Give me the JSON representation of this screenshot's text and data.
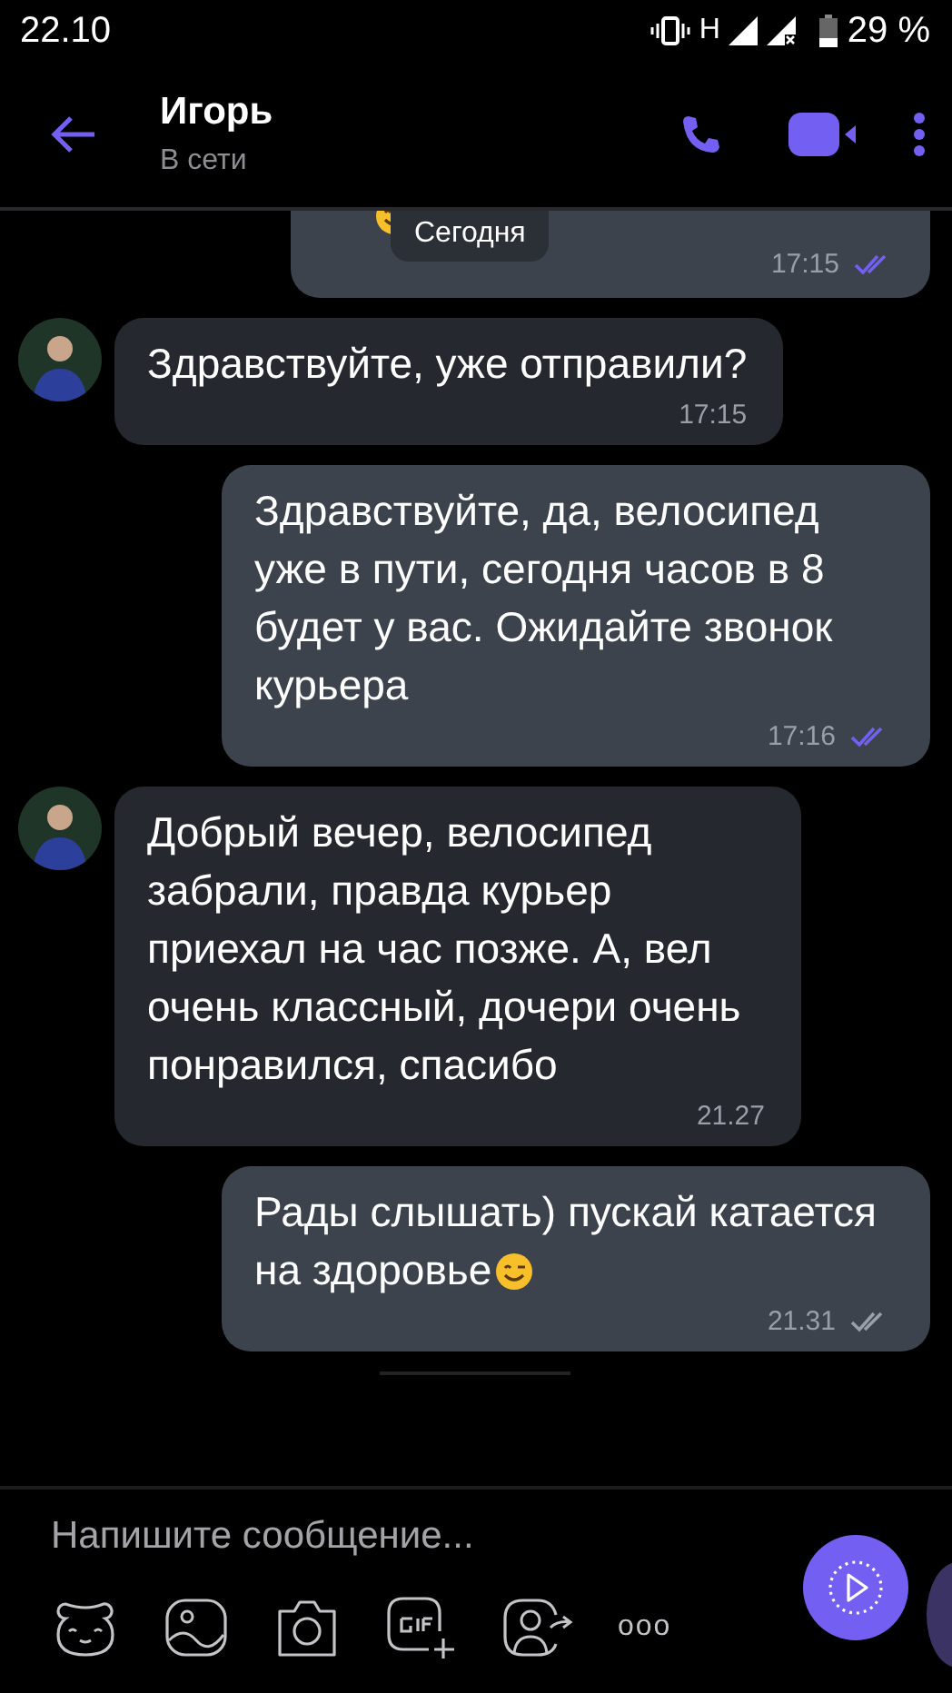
{
  "status_bar": {
    "time": "22.10",
    "network": "H",
    "battery": "29 %"
  },
  "header": {
    "name": "Игорь",
    "status": "В сети"
  },
  "date_chip": "Сегодня",
  "messages": [
    {
      "kind": "outgoing",
      "time": "17:15",
      "read": true,
      "clipped": true
    },
    {
      "kind": "incoming",
      "text": "Здравствуйте, уже отправили?",
      "time": "17:15"
    },
    {
      "kind": "outgoing",
      "text": "Здравствуйте, да, велосипед уже в пути, сегодня часов в 8 будет у вас. Ожидайте звонок курьера",
      "time": "17:16",
      "read": true
    },
    {
      "kind": "incoming",
      "text": "Добрый вечер, велосипед забрали, правда курьер приехал на час позже. А, вел очень классный, дочери очень понравился, спасибо",
      "time": "21.27"
    },
    {
      "kind": "outgoing",
      "text": "Рады слышать) пускай катается на здоровье",
      "wink_emoji": true,
      "time": "21.31",
      "read": false
    }
  ],
  "composer": {
    "placeholder": "Напишите сообщение...",
    "more": "ooo"
  }
}
